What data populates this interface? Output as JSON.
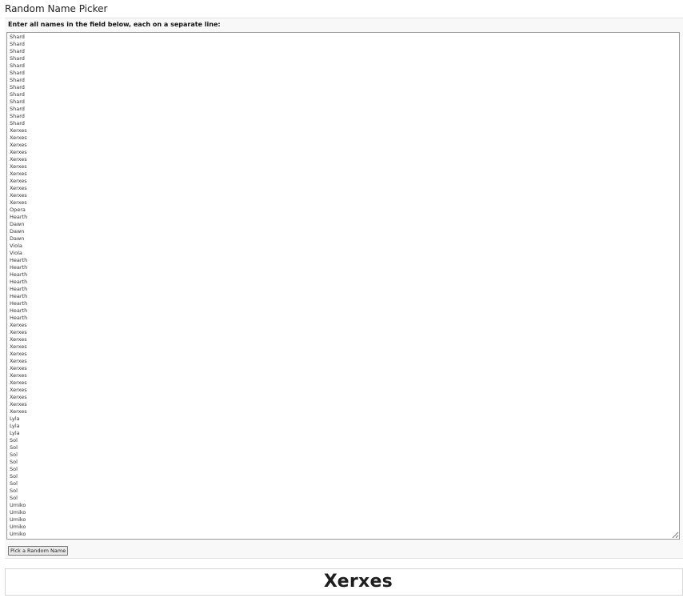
{
  "page": {
    "title": "Random Name Picker"
  },
  "form": {
    "instructions": "Enter all names in the field below, each on a separate line:",
    "names_value": "Shard\nShard\nShard\nShard\nShard\nShard\nShard\nShard\nShard\nShard\nShard\nShard\nShard\nXerxes\nXerxes\nXerxes\nXerxes\nXerxes\nXerxes\nXerxes\nXerxes\nXerxes\nXerxes\nXerxes\nOpera\nHearth\nDawn\nDawn\nDawn\nViola\nViola\nHearth\nHearth\nHearth\nHearth\nHearth\nHearth\nHearth\nHearth\nHearth\nXerxes\nXerxes\nXerxes\nXerxes\nXerxes\nXerxes\nXerxes\nXerxes\nXerxes\nXerxes\nXerxes\nXerxes\nXerxes\nLyla\nLyla\nLyla\nSol\nSol\nSol\nSol\nSol\nSol\nSol\nSol\nSol\nUmiko\nUmiko\nUmiko\nUmiko\nUmiko\nUmiko",
    "pick_button_label": "Pick a Random Name"
  },
  "result": {
    "picked_name": "Xerxes"
  }
}
